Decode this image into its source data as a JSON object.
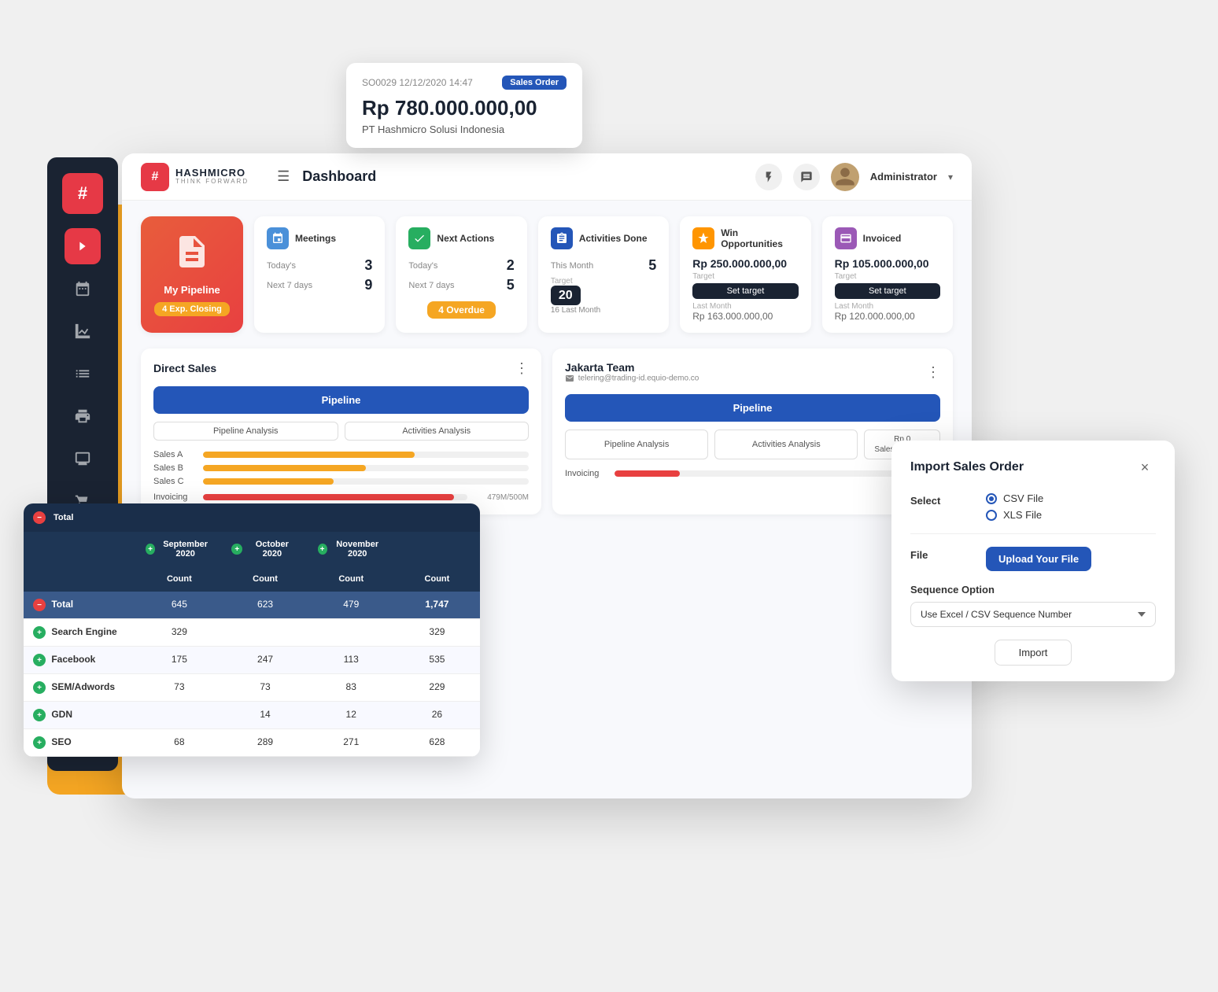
{
  "app": {
    "brand_name": "HASHMICRO",
    "brand_sub": "THINK FORWARD",
    "title": "Dashboard"
  },
  "topbar": {
    "menu_icon": "☰",
    "lightning_icon": "⚡",
    "message_icon": "💬",
    "user_name": "Administrator",
    "user_dropdown": "▾"
  },
  "tooltip": {
    "order_id": "SO0029 12/12/2020 14:47",
    "badge_label": "Sales Order",
    "amount": "Rp 780.000.000,00",
    "company": "PT Hashmicro Solusi Indonesia"
  },
  "kpi": {
    "my_pipeline_label": "My Pipeline",
    "exp_closing_label": "4 Exp. Closing",
    "meetings": {
      "title": "Meetings",
      "today_label": "Today's",
      "today_value": "3",
      "next7_label": "Next 7 days",
      "next7_value": "9"
    },
    "next_actions": {
      "title": "Next Actions",
      "today_label": "Today's",
      "today_value": "2",
      "next7_label": "Next 7 days",
      "next7_value": "5",
      "overdue_label": "4 Overdue"
    },
    "activities_done": {
      "title": "Activities Done",
      "this_month_label": "This Month",
      "this_month_value": "5",
      "target_label": "Target",
      "target_value": "20",
      "last_month_label": "Last Month",
      "last_month_value": "16 Last Month"
    },
    "win_opportunities": {
      "title": "Win Opportunities",
      "amount": "Rp 250.000.000,00",
      "target_label": "Target",
      "set_target": "Set target",
      "last_month_label": "Last Month",
      "last_month_value": "Rp 163.000.000,00"
    },
    "invoiced": {
      "title": "Invoiced",
      "amount": "Rp 105.000.000,00",
      "target_label": "Target",
      "set_target": "Set target",
      "last_month_label": "Last Month",
      "last_month_value": "Rp 120.000.000,00"
    }
  },
  "direct_sales": {
    "title": "Direct Sales",
    "pipeline_btn": "Pipeline",
    "analysis_btn1": "Pipeline Analysis",
    "analysis_btn2": "Activities Analysis",
    "progress_items": [
      {
        "label": "Sales A",
        "pct": 65
      },
      {
        "label": "Sales B",
        "pct": 50
      },
      {
        "label": "Sales C",
        "pct": 40
      }
    ],
    "invoicing_label": "Invoicing",
    "invoicing_value": "479M/500M",
    "invoicing_pct": 95
  },
  "jakarta_team": {
    "title": "Jakarta Team",
    "email": "telering@trading-id.equio-demo.co",
    "pipeline_btn": "Pipeline",
    "analysis_btn1": "Pipeline Analysis",
    "analysis_btn2": "Activities Analysis",
    "sales_invoice_btn": "Rp 0\nSales to Invoice",
    "invoicing_label": "Invoicing",
    "invoicing_pct": 20
  },
  "data_table": {
    "header_total": "Total",
    "col_sep2020": "September 2020",
    "col_oct2020": "October 2020",
    "col_nov2020": "November 2020",
    "col_count": "Count",
    "rows": [
      {
        "label": "Total",
        "type": "minus",
        "sep": "645",
        "oct": "623",
        "nov": "479",
        "total": "1,747"
      },
      {
        "label": "Search Engine",
        "type": "plus",
        "sep": "329",
        "oct": "",
        "nov": "",
        "total": "329"
      },
      {
        "label": "Facebook",
        "type": "plus",
        "sep": "175",
        "oct": "247",
        "nov": "113",
        "total": "535"
      },
      {
        "label": "SEM/Adwords",
        "type": "plus",
        "sep": "73",
        "oct": "73",
        "nov": "83",
        "total": "229"
      },
      {
        "label": "GDN",
        "type": "plus",
        "sep": "",
        "oct": "14",
        "nov": "12",
        "total": "26"
      },
      {
        "label": "SEO",
        "type": "plus",
        "sep": "68",
        "oct": "289",
        "nov": "271",
        "total": "628"
      }
    ]
  },
  "import_dialog": {
    "title": "Import Sales Order",
    "close_icon": "×",
    "select_label": "Select",
    "csv_option": "CSV File",
    "xls_option": "XLS File",
    "file_label": "File",
    "upload_btn": "Upload Your File",
    "sequence_label": "Sequence Option",
    "sequence_value": "Use Excel / CSV Sequence Number",
    "import_btn": "Import"
  },
  "sidebar": {
    "items": [
      {
        "icon": "»",
        "label": "nav-arrows"
      },
      {
        "icon": "📅",
        "label": "calendar"
      },
      {
        "icon": "📊",
        "label": "chart"
      },
      {
        "icon": "📋",
        "label": "list"
      },
      {
        "icon": "🖨️",
        "label": "printer"
      },
      {
        "icon": "🖥️",
        "label": "monitor"
      },
      {
        "icon": "🛒",
        "label": "cart"
      }
    ]
  }
}
